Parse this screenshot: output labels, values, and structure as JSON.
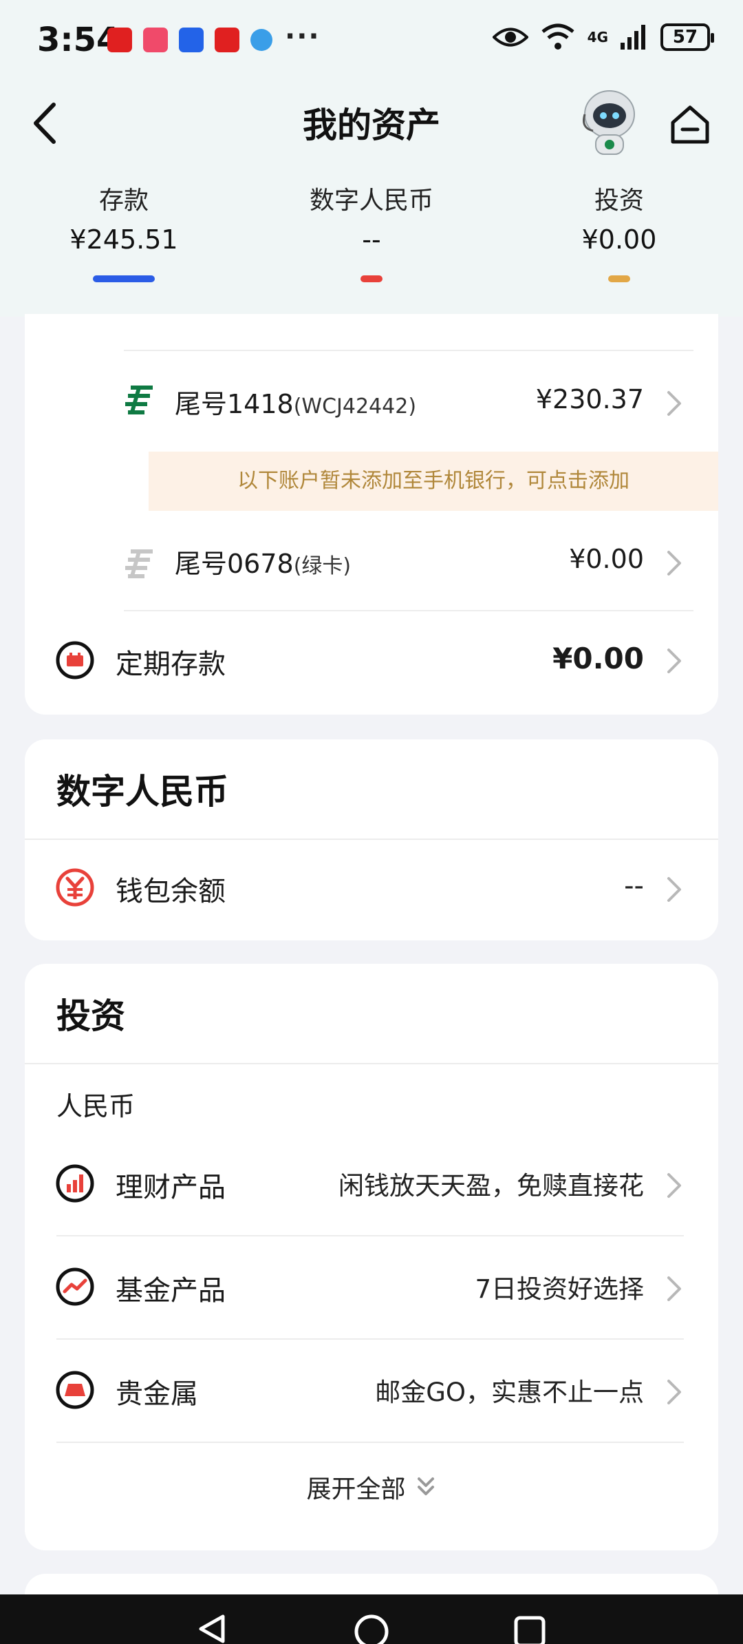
{
  "status_bar": {
    "time": "3:54",
    "network": "4G",
    "battery": "57",
    "more": "···",
    "icons": [
      "huawei-app-icon",
      "618-app-icon",
      "voice-app-icon",
      "huawei-app-icon",
      "browser-icon",
      "eye-icon",
      "wifi-icon",
      "signal-icon",
      "battery-icon"
    ]
  },
  "header": {
    "title": "我的资产",
    "back_icon": "chevron-left-icon",
    "home_icon": "home-icon",
    "assistant_icon": "robot-avatar-icon"
  },
  "asset_tabs": [
    {
      "label": "存款",
      "value": "¥245.51",
      "color": "#2b5ce6"
    },
    {
      "label": "数字人民币",
      "value": "--",
      "color": "#e8413a"
    },
    {
      "label": "投资",
      "value": "¥0.00",
      "color": "#e2a746"
    }
  ],
  "deposits": {
    "accounts": [
      {
        "tail": "尾号1418",
        "name": "(WCJ42442)",
        "amount": "¥230.37",
        "active": true
      }
    ],
    "notice": "以下账户暂未添加至手机银行，可点击添加",
    "inactive_accounts": [
      {
        "tail": "尾号0678",
        "name": "(绿卡)",
        "amount": "¥0.00",
        "active": false
      }
    ],
    "fixed": {
      "label": "定期存款",
      "amount": "¥0.00"
    }
  },
  "digital_rmb": {
    "title": "数字人民币",
    "wallet_label": "钱包余额",
    "wallet_value": "--"
  },
  "investment": {
    "title": "投资",
    "currency": "人民币",
    "items": [
      {
        "label": "理财产品",
        "desc": "闲钱放天天盈，免赎直接花"
      },
      {
        "label": "基金产品",
        "desc": "7日投资好选择"
      },
      {
        "label": "贵金属",
        "desc": "邮金GO，实惠不止一点"
      }
    ],
    "expand": "展开全部"
  },
  "colors": {
    "accent_blue": "#2b5ce6",
    "accent_red": "#e8413a",
    "accent_gold": "#e2a746",
    "postal_green": "#0f7a43",
    "notice_text": "#b0873a"
  }
}
